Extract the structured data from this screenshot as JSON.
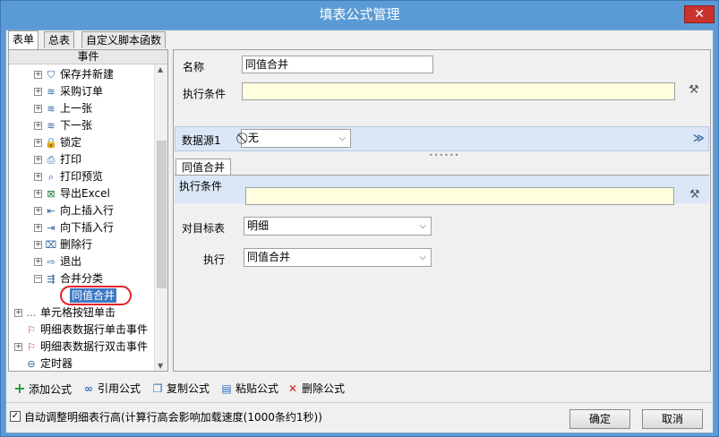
{
  "window": {
    "title": "填表公式管理",
    "close_glyph": "✕"
  },
  "tabs": [
    "表单",
    "总表",
    "自定义脚本函数"
  ],
  "tree": {
    "header": "事件",
    "items": [
      {
        "label": "保存并新建",
        "icon": "shield-icon",
        "glyph": "⛉"
      },
      {
        "label": "采购订单",
        "icon": "stack-icon",
        "glyph": "≋"
      },
      {
        "label": "上一张",
        "icon": "stack-icon",
        "glyph": "≋"
      },
      {
        "label": "下一张",
        "icon": "stack-icon",
        "glyph": "≋"
      },
      {
        "label": "锁定",
        "icon": "lock-icon",
        "glyph": "🔒"
      },
      {
        "label": "打印",
        "icon": "printer-icon",
        "glyph": "⎙"
      },
      {
        "label": "打印预览",
        "icon": "print-preview-icon",
        "glyph": "⌕"
      },
      {
        "label": "导出Excel",
        "icon": "excel-icon",
        "glyph": "⊠"
      },
      {
        "label": "向上插入行",
        "icon": "insert-above-icon",
        "glyph": "⇤"
      },
      {
        "label": "向下插入行",
        "icon": "insert-below-icon",
        "glyph": "⇥"
      },
      {
        "label": "删除行",
        "icon": "delete-row-icon",
        "glyph": "⌧"
      },
      {
        "label": "退出",
        "icon": "exit-icon",
        "glyph": "⇨"
      },
      {
        "label": "合并分类",
        "icon": "merge-icon",
        "glyph": "⇶"
      }
    ],
    "selected": "同值合并",
    "bottom": [
      {
        "label": "单元格按钮单击",
        "icon": "dots-icon",
        "glyph": "…"
      },
      {
        "label": "明细表数据行单击事件",
        "icon": "flag-icon",
        "glyph": "⚐"
      },
      {
        "label": "明细表数据行双击事件",
        "icon": "flag-icon",
        "glyph": "⚐"
      },
      {
        "label": "定时器",
        "icon": "timer-icon",
        "glyph": "⊖"
      }
    ]
  },
  "form": {
    "name_label": "名称",
    "name_value": "同值合并",
    "condition_label": "执行条件",
    "condition_value": "",
    "datasource_label": "数据源1",
    "datasource_value": "无",
    "datasource_glyph": "⃠",
    "collapse_glyph": "≫",
    "subtab": "同值合并",
    "sub_condition_label": "执行条件",
    "sub_condition_value": "",
    "target_label": "对目标表",
    "target_value": "明细",
    "exec_label": "执行",
    "exec_value": "同值合并"
  },
  "toolbar": [
    {
      "label": "添加公式",
      "icon": "add-icon",
      "glyph": "+",
      "color": "#1e9e3a"
    },
    {
      "label": "引用公式",
      "icon": "link-icon",
      "glyph": "∞",
      "color": "#2e6fc0"
    },
    {
      "label": "复制公式",
      "icon": "copy-icon",
      "glyph": "❐",
      "color": "#2e6fc0"
    },
    {
      "label": "粘贴公式",
      "icon": "paste-icon",
      "glyph": "▤",
      "color": "#2e6fc0"
    },
    {
      "label": "删除公式",
      "icon": "delete-icon",
      "glyph": "✕",
      "color": "#d11a1a"
    }
  ],
  "footer": {
    "auto_height_checked": true,
    "auto_height_label": "自动调整明细表行高(计算行高会影响加载速度(1000条约1秒))",
    "ok": "确定",
    "cancel": "取消"
  }
}
